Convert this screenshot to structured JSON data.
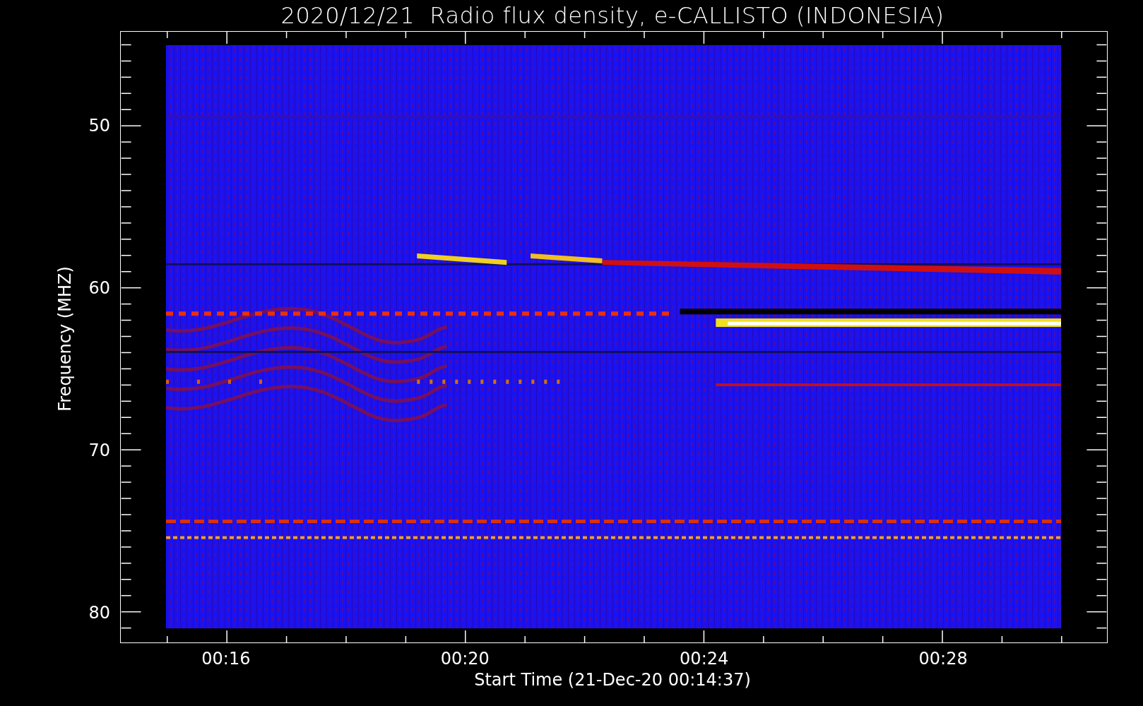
{
  "title": "2020/12/21  Radio flux density, e-CALLISTO (INDONESIA)",
  "y_axis": {
    "label": "Frequency (MHZ)",
    "ticks": [
      "50",
      "60",
      "70",
      "80"
    ]
  },
  "x_axis": {
    "label": "Start Time (21-Dec-20 00:14:37)",
    "ticks": [
      "00:16",
      "00:20",
      "00:24",
      "00:28"
    ]
  }
}
